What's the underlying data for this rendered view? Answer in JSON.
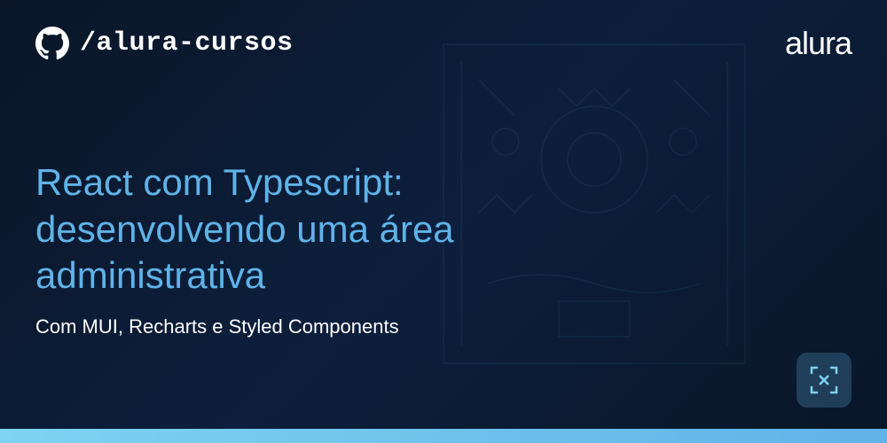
{
  "header": {
    "repo_name": "/alura-cursos",
    "brand": "alura"
  },
  "content": {
    "title": "React com Typescript: desenvolvendo uma área administrativa",
    "subtitle": "Com MUI, Recharts e Styled Components"
  },
  "colors": {
    "accent": "#5fb3e8",
    "background_dark": "#0a1628"
  }
}
